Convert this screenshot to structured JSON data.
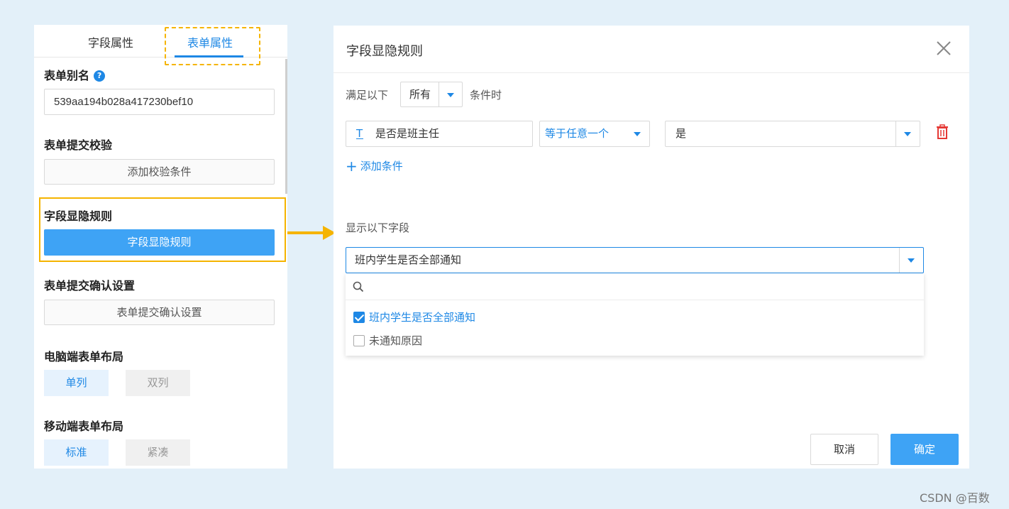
{
  "left_panel": {
    "tabs": [
      {
        "label": "字段属性"
      },
      {
        "label": "表单属性"
      }
    ],
    "alias": {
      "title": "表单别名",
      "help": "?",
      "value": "539aa194b028a417230bef10"
    },
    "submit_validation": {
      "title": "表单提交校验",
      "button": "添加校验条件"
    },
    "visibility_rule": {
      "title": "字段显隐规则",
      "button": "字段显隐规则"
    },
    "submit_confirm": {
      "title": "表单提交确认设置",
      "button": "表单提交确认设置"
    },
    "pc_layout": {
      "title": "电脑端表单布局",
      "options": [
        "单列",
        "双列"
      ],
      "selected": "单列"
    },
    "mobile_layout": {
      "title": "移动端表单布局",
      "options": [
        "标准",
        "紧凑"
      ],
      "selected": "标准"
    }
  },
  "dialog": {
    "title": "字段显隐规则",
    "condition": {
      "prefix": "满足以下",
      "match": "所有",
      "suffix": "条件时"
    },
    "rule": {
      "field": "是否是班主任",
      "field_icon": "T",
      "operator": "等于任意一个",
      "value": "是"
    },
    "add_condition": "添加条件",
    "show_fields_label": "显示以下字段",
    "selected_fields": "班内学生是否全部通知",
    "search_placeholder": "",
    "options": [
      {
        "label": "班内学生是否全部通知",
        "checked": true
      },
      {
        "label": "未通知原因",
        "checked": false
      }
    ],
    "cancel": "取消",
    "ok": "确定"
  },
  "watermark": "CSDN @百数",
  "colors": {
    "accent": "#1e88e5",
    "primary_button": "#3ea3f5",
    "highlight": "#f5b400",
    "danger": "#e53935",
    "background": "#e3f0f9"
  }
}
